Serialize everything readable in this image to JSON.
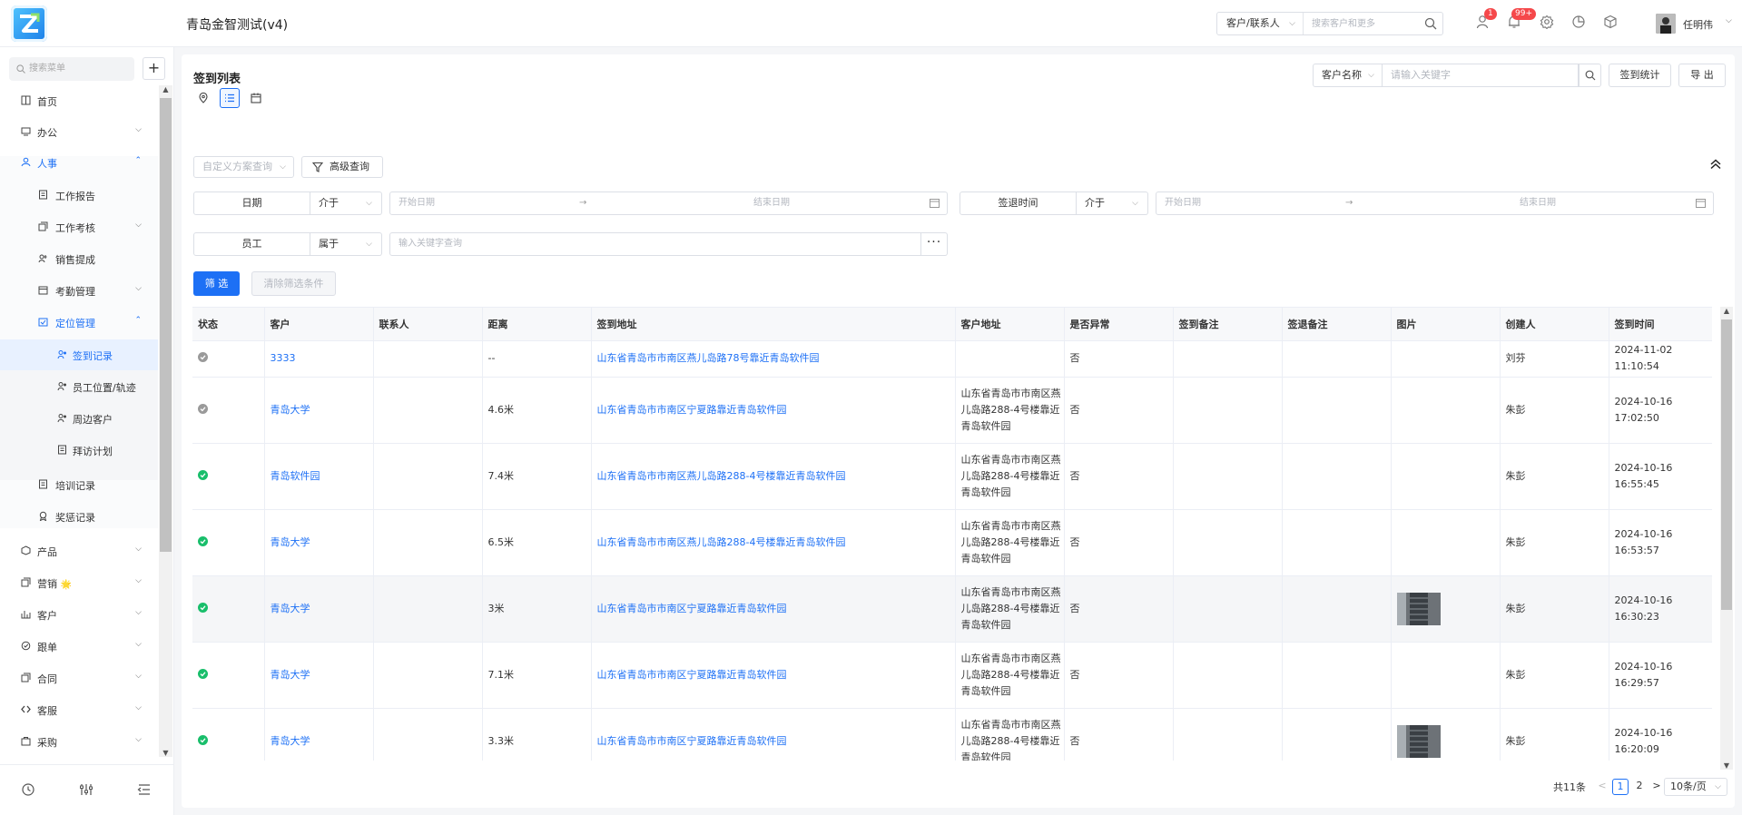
{
  "header": {
    "app_title": "青岛金智测试(v4)",
    "search_type": "客户/联系人",
    "search_placeholder": "搜索客户和更多",
    "badge_user": "1",
    "badge_bell": "99+",
    "user_name": "任明伟"
  },
  "sidebar": {
    "search_placeholder": "搜索菜单",
    "add_label": "+",
    "items": [
      {
        "label": "首页",
        "icon": "home-icon"
      },
      {
        "label": "办公",
        "icon": "office-icon"
      },
      {
        "label": "人事",
        "icon": "hr-icon"
      },
      {
        "label": "工作报告",
        "icon": "report-icon"
      },
      {
        "label": "工作考核",
        "icon": "assessment-icon"
      },
      {
        "label": "销售提成",
        "icon": "commission-icon"
      },
      {
        "label": "考勤管理",
        "icon": "attendance-icon"
      },
      {
        "label": "定位管理",
        "icon": "location-manage-icon"
      },
      {
        "label": "签到记录",
        "icon": "checkin-icon"
      },
      {
        "label": "员工位置/轨迹",
        "icon": "track-icon"
      },
      {
        "label": "周边客户",
        "icon": "nearby-icon"
      },
      {
        "label": "拜访计划",
        "icon": "visit-plan-icon"
      },
      {
        "label": "培训记录",
        "icon": "training-icon"
      },
      {
        "label": "奖惩记录",
        "icon": "reward-icon"
      },
      {
        "label": "产品",
        "icon": "product-icon"
      },
      {
        "label": "营销",
        "icon": "marketing-icon",
        "emoji": "🌟"
      },
      {
        "label": "客户",
        "icon": "customer-icon"
      },
      {
        "label": "跟单",
        "icon": "follow-icon"
      },
      {
        "label": "合同",
        "icon": "contract-icon"
      },
      {
        "label": "客服",
        "icon": "service-icon"
      },
      {
        "label": "采购",
        "icon": "purchase-icon"
      }
    ]
  },
  "page": {
    "title": "签到列表",
    "filter_field": "客户名称",
    "keyword_placeholder": "请输入关键字",
    "stats_button": "签到统计",
    "export_button": "导 出",
    "custom_query": "自定义方案查询",
    "advanced_query": "高级查询",
    "filters": {
      "date_label": "日期",
      "date_op": "介于",
      "date_start": "开始日期",
      "date_end": "结束日期",
      "checkout_label": "签退时间",
      "checkout_op": "介于",
      "checkout_start": "开始日期",
      "checkout_end": "结束日期",
      "employee_label": "员工",
      "employee_op": "属于",
      "employee_placeholder": "输入关键字查询",
      "arrow": "→",
      "more": "···"
    },
    "filter_button": "筛 选",
    "clear_button": "清除筛选条件"
  },
  "table": {
    "columns": [
      "状态",
      "客户",
      "联系人",
      "距离",
      "签到地址",
      "客户地址",
      "是否异常",
      "签到备注",
      "签退备注",
      "图片",
      "创建人",
      "签到时间"
    ],
    "rows": [
      {
        "status": "gray",
        "customer": "3333",
        "contact": "",
        "distance": "--",
        "address": "山东省青岛市市南区燕儿岛路78号靠近青岛软件园",
        "customer_address": "",
        "abnormal": "否",
        "checkin_note": "",
        "checkout_note": "",
        "image": "",
        "creator": "刘芬",
        "time": "2024-11-02 11:10:54"
      },
      {
        "status": "gray",
        "customer": "青岛大学",
        "contact": "",
        "distance": "4.6米",
        "address": "山东省青岛市市南区宁夏路靠近青岛软件园",
        "customer_address": "山东省青岛市市南区燕儿岛路288-4号楼靠近青岛软件园",
        "abnormal": "否",
        "checkin_note": "",
        "checkout_note": "",
        "image": "",
        "creator": "朱彭",
        "time": "2024-10-16 17:02:50"
      },
      {
        "status": "green",
        "customer": "青岛软件园",
        "contact": "",
        "distance": "7.4米",
        "address": "山东省青岛市市南区燕儿岛路288-4号楼靠近青岛软件园",
        "customer_address": "山东省青岛市市南区燕儿岛路288-4号楼靠近青岛软件园",
        "abnormal": "否",
        "checkin_note": "",
        "checkout_note": "",
        "image": "",
        "creator": "朱彭",
        "time": "2024-10-16 16:55:45"
      },
      {
        "status": "green",
        "customer": "青岛大学",
        "contact": "",
        "distance": "6.5米",
        "address": "山东省青岛市市南区燕儿岛路288-4号楼靠近青岛软件园",
        "customer_address": "山东省青岛市市南区燕儿岛路288-4号楼靠近青岛软件园",
        "abnormal": "否",
        "checkin_note": "",
        "checkout_note": "",
        "image": "",
        "creator": "朱彭",
        "time": "2024-10-16 16:53:57"
      },
      {
        "status": "green",
        "customer": "青岛大学",
        "contact": "",
        "distance": "3米",
        "address": "山东省青岛市市南区宁夏路靠近青岛软件园",
        "customer_address": "山东省青岛市市南区燕儿岛路288-4号楼靠近青岛软件园",
        "abnormal": "否",
        "checkin_note": "",
        "checkout_note": "",
        "image": "photo",
        "creator": "朱彭",
        "time": "2024-10-16 16:30:23"
      },
      {
        "status": "green",
        "customer": "青岛大学",
        "contact": "",
        "distance": "7.1米",
        "address": "山东省青岛市市南区宁夏路靠近青岛软件园",
        "customer_address": "山东省青岛市市南区燕儿岛路288-4号楼靠近青岛软件园",
        "abnormal": "否",
        "checkin_note": "",
        "checkout_note": "",
        "image": "",
        "creator": "朱彭",
        "time": "2024-10-16 16:29:57"
      },
      {
        "status": "green",
        "customer": "青岛大学",
        "contact": "",
        "distance": "3.3米",
        "address": "山东省青岛市市南区宁夏路靠近青岛软件园",
        "customer_address": "山东省青岛市市南区燕儿岛路288-4号楼靠近青岛软件园",
        "abnormal": "否",
        "checkin_note": "",
        "checkout_note": "",
        "image": "photo",
        "creator": "朱彭",
        "time": "2024-10-16 16:20:09"
      }
    ]
  },
  "pagination": {
    "total": "共11条",
    "prev": "<",
    "pages": [
      "1",
      "2"
    ],
    "next": ">",
    "page_size": "10条/页"
  },
  "colors": {
    "primary": "#1d70f5",
    "status_ok": "#19be6b",
    "status_gray": "#9a9a9a",
    "badge": "#f5484a"
  }
}
